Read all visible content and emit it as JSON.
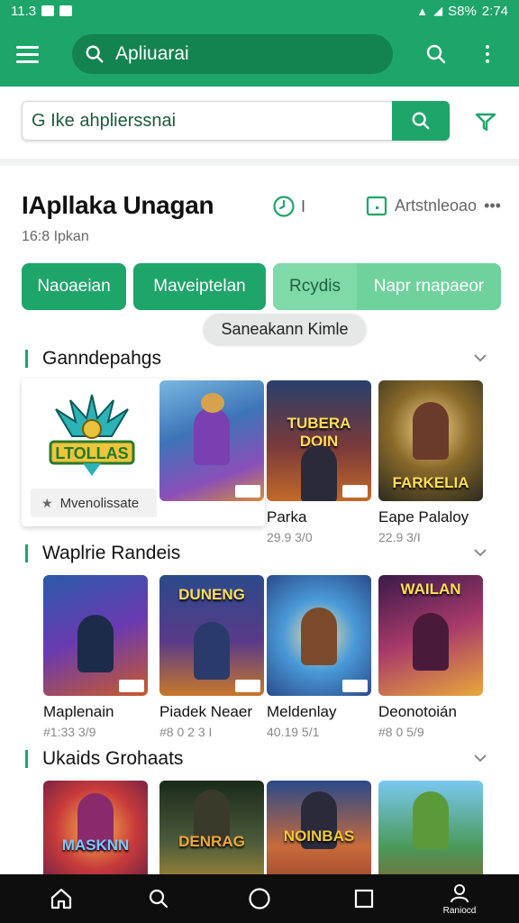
{
  "status_bar": {
    "time_left": "11.3",
    "battery": "S8%",
    "time_right": "2:74"
  },
  "app_bar": {
    "search_value": "Apliuarai",
    "menu_icon": "hamburger-menu-icon",
    "search_icon": "search-icon",
    "more_icon": "more-vert-icon"
  },
  "search": {
    "value": "G Ike ahplierssnai",
    "button_icon": "search-icon",
    "filter_icon": "filter-icon"
  },
  "header": {
    "title": "IApllaka Unagan",
    "subtitle": "16:8 Ipkan",
    "timer_label": "I",
    "artist_label": "Artstnleoao"
  },
  "tabs": [
    {
      "label": "Naoaeian",
      "active": true
    },
    {
      "label": "Maveiptelan",
      "active": true
    },
    {
      "label": "Rcydis",
      "active": false
    },
    {
      "label": "Napr rnapaeor",
      "active": false
    }
  ],
  "tooltip": "Saneakann Kimle",
  "sections": [
    {
      "title": "Ganndepahgs",
      "feature": {
        "chip_label": "Mvenolissate",
        "logo_text": "LTOLLAS"
      },
      "items": [
        {
          "name": "",
          "stat": ""
        },
        {
          "name": "Parka",
          "stat": "29.9 3/0",
          "art": "TUBERA DOIN"
        },
        {
          "name": "Eape Palaloy",
          "stat": "22.9 3/I",
          "art": "FARKELIA"
        }
      ]
    },
    {
      "title": "Waplrie Randeis",
      "items": [
        {
          "name": "Maplenain",
          "stat": "#1:33 3/9",
          "art": ""
        },
        {
          "name": "Piadek Neaer",
          "stat": "#8 0 2 3 I",
          "art": "DUNENG"
        },
        {
          "name": "Meldenlay",
          "stat": "40.19 5/1",
          "art": ""
        },
        {
          "name": "Deonotoián",
          "stat": "#8 0 5/9",
          "art": "WAILAN"
        }
      ]
    },
    {
      "title": "Ukaids Grohaats",
      "items": [
        {
          "name": "",
          "stat": "",
          "art": "MASKNN"
        },
        {
          "name": "",
          "stat": "",
          "art": "DENRAG"
        },
        {
          "name": "",
          "stat": "",
          "art": "NOINBAS"
        },
        {
          "name": "",
          "stat": "",
          "art": ""
        }
      ]
    }
  ],
  "bottom_nav": [
    {
      "icon": "home-icon",
      "label": ""
    },
    {
      "icon": "search-icon",
      "label": ""
    },
    {
      "icon": "circle-home-icon",
      "label": ""
    },
    {
      "icon": "square-recents-icon",
      "label": ""
    },
    {
      "icon": "profile-icon",
      "label": "Raniocd"
    }
  ],
  "colors": {
    "primary": "#1ea56a",
    "primary_dark": "#13834f",
    "tab_light": "#7fd9a8",
    "nav_bg": "#0e0e0e"
  }
}
